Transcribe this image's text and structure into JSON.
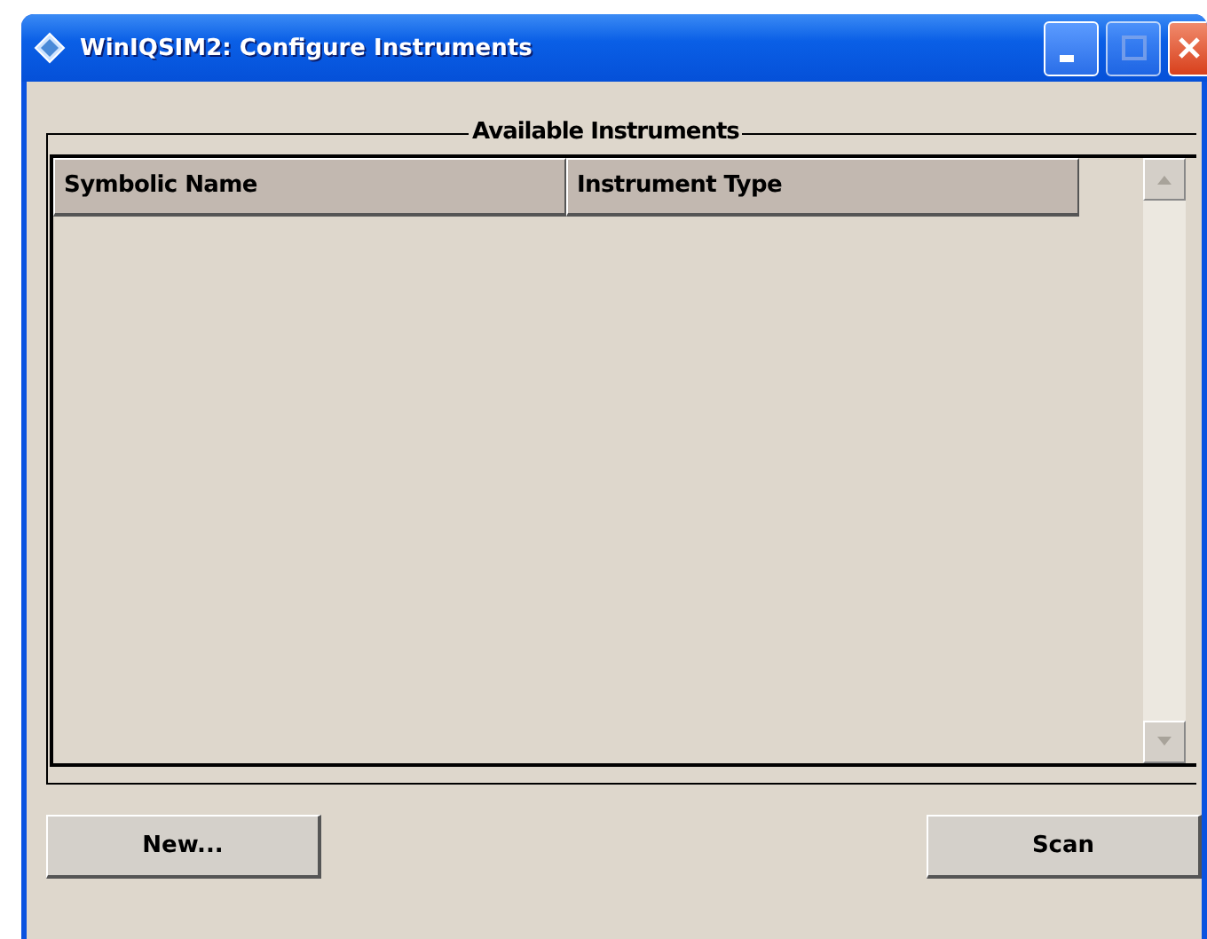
{
  "window": {
    "title": "WinIQSIM2: Configure Instruments"
  },
  "group": {
    "title": "Available Instruments"
  },
  "table": {
    "columns": [
      "Symbolic Name",
      "Instrument Type"
    ]
  },
  "buttons": [
    {
      "label": "New..."
    },
    {
      "label": "Scan"
    }
  ]
}
